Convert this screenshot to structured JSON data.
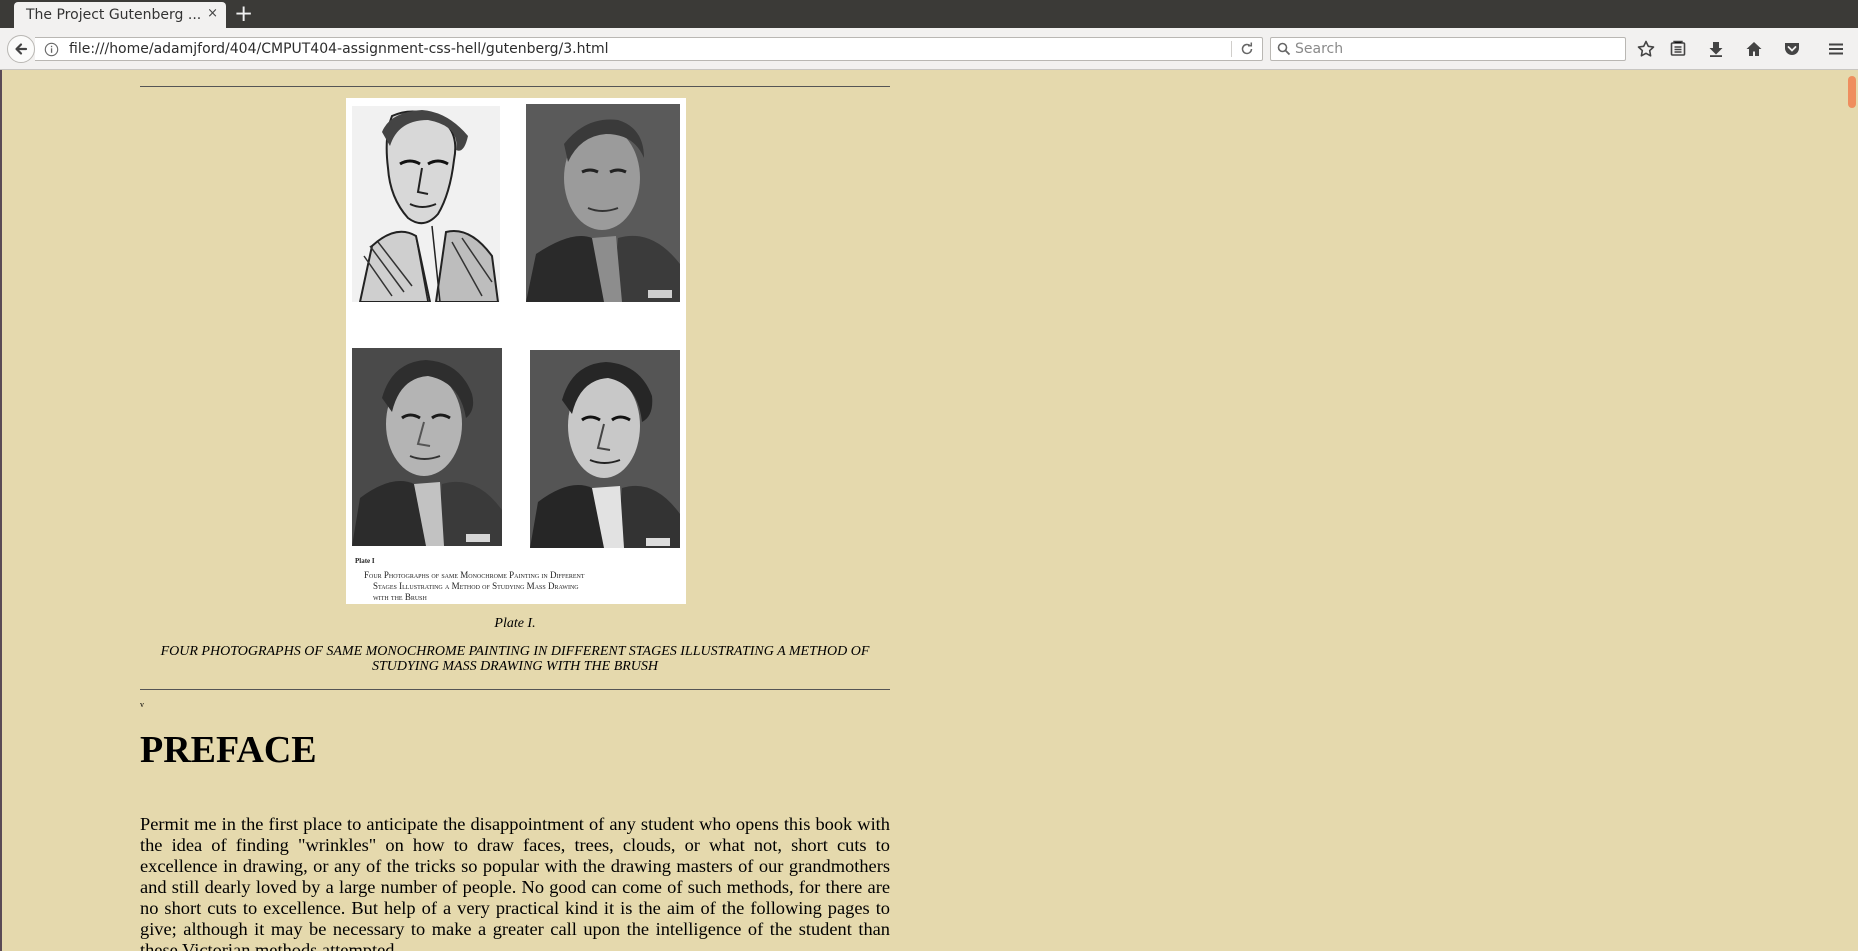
{
  "browser": {
    "tab_title": "The Project Gutenberg ...",
    "tab_close": "×",
    "new_tab": "+",
    "url": "file:///home/adamjford/404/CMPUT404-assignment-css-hell/gutenberg/3.html",
    "search_placeholder": "Search",
    "toolbar_icons": [
      "back-icon",
      "info-icon",
      "reload-icon",
      "search-icon",
      "bookmark-star-icon",
      "reading-list-icon",
      "downloads-icon",
      "home-icon",
      "pocket-icon",
      "menu-icon"
    ]
  },
  "plate": {
    "label": "Plate I",
    "caption_lines": [
      "Four Photographs of same Monochrome Painting in Different",
      "Stages Illustrating a Method of Studying Mass Drawing",
      "with the Brush"
    ]
  },
  "caption": {
    "title": "Plate I.",
    "text": "FOUR PHOTOGRAPHS OF SAME MONOCHROME PAINTING IN DIFFERENT STAGES ILLUSTRATING A METHOD OF STUDYING MASS DRAWING WITH THE BRUSH"
  },
  "page_number": "v",
  "preface": {
    "heading": "PREFACE",
    "paragraph": "Permit me in the first place to anticipate the disappointment of any student who opens this book with the idea of finding \"wrinkles\" on how to draw faces, trees, clouds, or what not, short cuts to excellence in drawing, or any of the tricks so popular with the drawing masters of our grandmothers and still dearly loved by a large number of people. No good can come of such methods, for there are no short cuts to excellence. But help of a very practical kind it is the aim of the following pages to give; although it may be necessary to make a greater call upon the intelligence of the student than these Victorian methods attempted."
  },
  "colors": {
    "page_background": "#e5d9ad",
    "chrome_dark": "#3b3a37",
    "toolbar": "#f2f1f0",
    "scroll_thumb": "#ef8e5e"
  }
}
